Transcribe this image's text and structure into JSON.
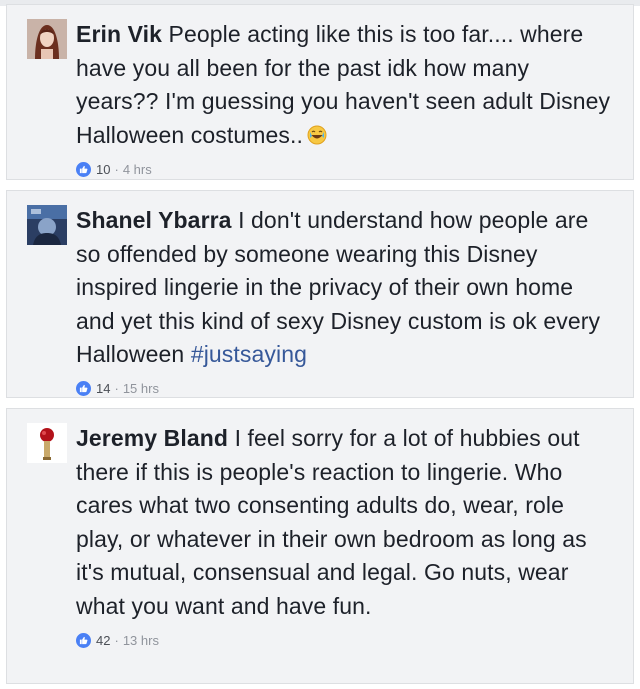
{
  "comments": [
    {
      "author": "Erin Vik",
      "text": "People acting like this is too far.... where have you all been for the past idk how many years?? I'm guessing you haven't seen adult Disney Halloween costumes..",
      "emoji": "laughing-emoji",
      "likes": "10",
      "time": "4 hrs"
    },
    {
      "author": "Shanel Ybarra",
      "text": "I don't understand how people are so offended by someone wearing this Disney inspired lingerie in the privacy of their own home and yet this kind of sexy Disney custom is ok every Halloween",
      "hashtag": "#justsaying",
      "likes": "14",
      "time": "15 hrs"
    },
    {
      "author": "Jeremy Bland",
      "text": "I feel sorry for a lot of hubbies out there if this is people's reaction to lingerie. Who cares what two consenting adults do, wear, role play, or whatever in their own bedroom as long as it's mutual, consensual and legal. Go nuts, wear what you want and have fun.",
      "likes": "42",
      "time": "13 hrs"
    }
  ],
  "colors": {
    "background": "#f2f3f5",
    "text": "#1d2129",
    "hashtag": "#365899",
    "meta": "#90949c",
    "like": "#4a80f5"
  }
}
